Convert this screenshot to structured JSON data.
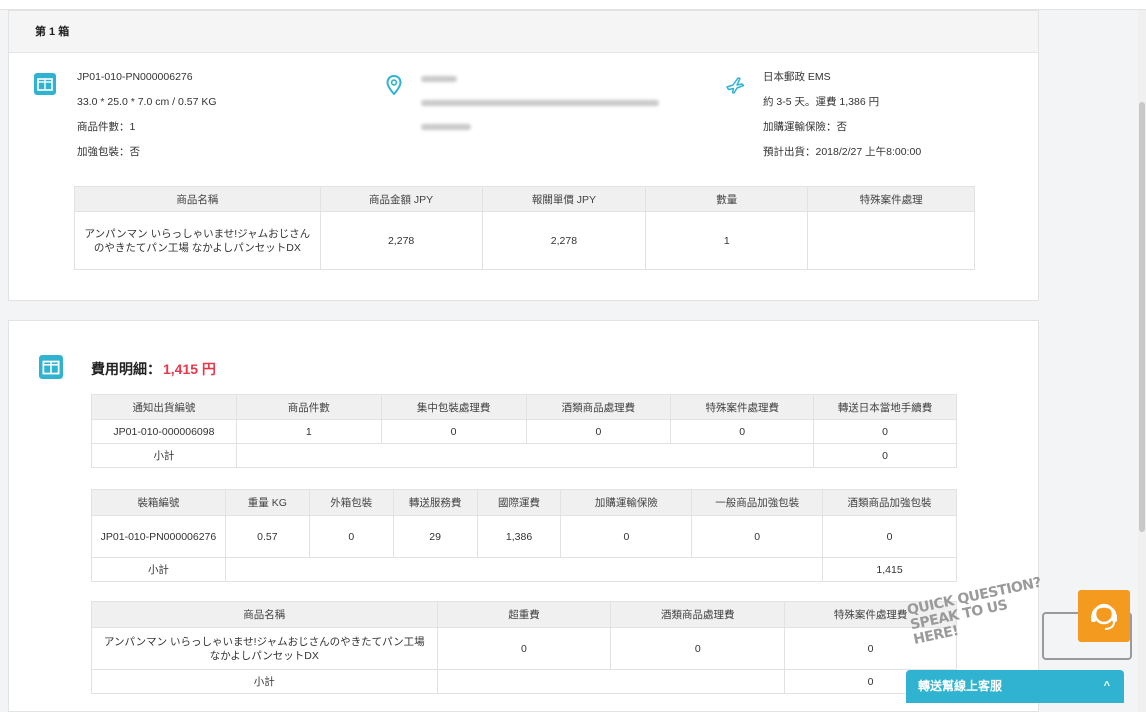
{
  "box": {
    "title": "第 1 箱",
    "package": {
      "id": "JP01-010-PN000006276",
      "dimensions": "33.0 * 25.0 * 7.0 cm / 0.57 KG",
      "item_count": "商品件數：1",
      "reinforced": "加強包裝：否"
    },
    "shipping": {
      "carrier": "日本郵政 EMS",
      "cost": "約 3-5 天。運費 1,386 円",
      "insurance": "加購運輸保險：否",
      "eta": "預計出貨：2018/2/27 上午8:00:00"
    },
    "items_table": {
      "headers": [
        "商品名稱",
        "商品金額 JPY",
        "報關單價 JPY",
        "數量",
        "特殊案件處理"
      ],
      "rows": [
        [
          "アンパンマン いらっしゃいませ!ジャムおじさんのやきたてパン工場 なかよしパンセットDX",
          "2,278",
          "2,278",
          "1",
          ""
        ]
      ]
    }
  },
  "fees": {
    "title": "費用明細：",
    "total": "1,415 円",
    "table1": {
      "headers": [
        "通知出貨編號",
        "商品件數",
        "集中包裝處理費",
        "酒類商品處理費",
        "特殊案件處理費",
        "轉送日本當地手續費"
      ],
      "rows": [
        [
          "JP01-010-000006098",
          "1",
          "0",
          "0",
          "0",
          "0"
        ]
      ],
      "subtotal_label": "小計",
      "subtotal": "0"
    },
    "table2": {
      "headers": [
        "裝箱編號",
        "重量 KG",
        "外箱包裝",
        "轉送服務費",
        "國際運費",
        "加購運輸保險",
        "一般商品加強包裝",
        "酒類商品加強包裝"
      ],
      "rows": [
        [
          "JP01-010-PN000006276",
          "0.57",
          "0",
          "29",
          "1,386",
          "0",
          "0",
          "0"
        ]
      ],
      "subtotal_label": "小計",
      "subtotal": "1,415"
    },
    "table3": {
      "headers": [
        "商品名稱",
        "超重費",
        "酒類商品處理費",
        "特殊案件處理費"
      ],
      "rows": [
        [
          "アンパンマン いらっしゃいませ!ジャムおじさんのやきたてパン工場 なかよしパンセットDX",
          "0",
          "0",
          "0"
        ]
      ],
      "subtotal_label": "小計",
      "subtotal": "0"
    }
  },
  "support": {
    "quick_question": "QUICK QUESTION? SPEAK TO US HERE!",
    "chat_label": "轉送幫線上客服"
  },
  "colors": {
    "accent": "#2fb3d0",
    "price": "#e8374a",
    "support": "#f49a1f"
  },
  "icons": [
    "box-icon",
    "location-pin-icon",
    "airplane-icon",
    "headset-icon",
    "chevron-up-icon"
  ]
}
